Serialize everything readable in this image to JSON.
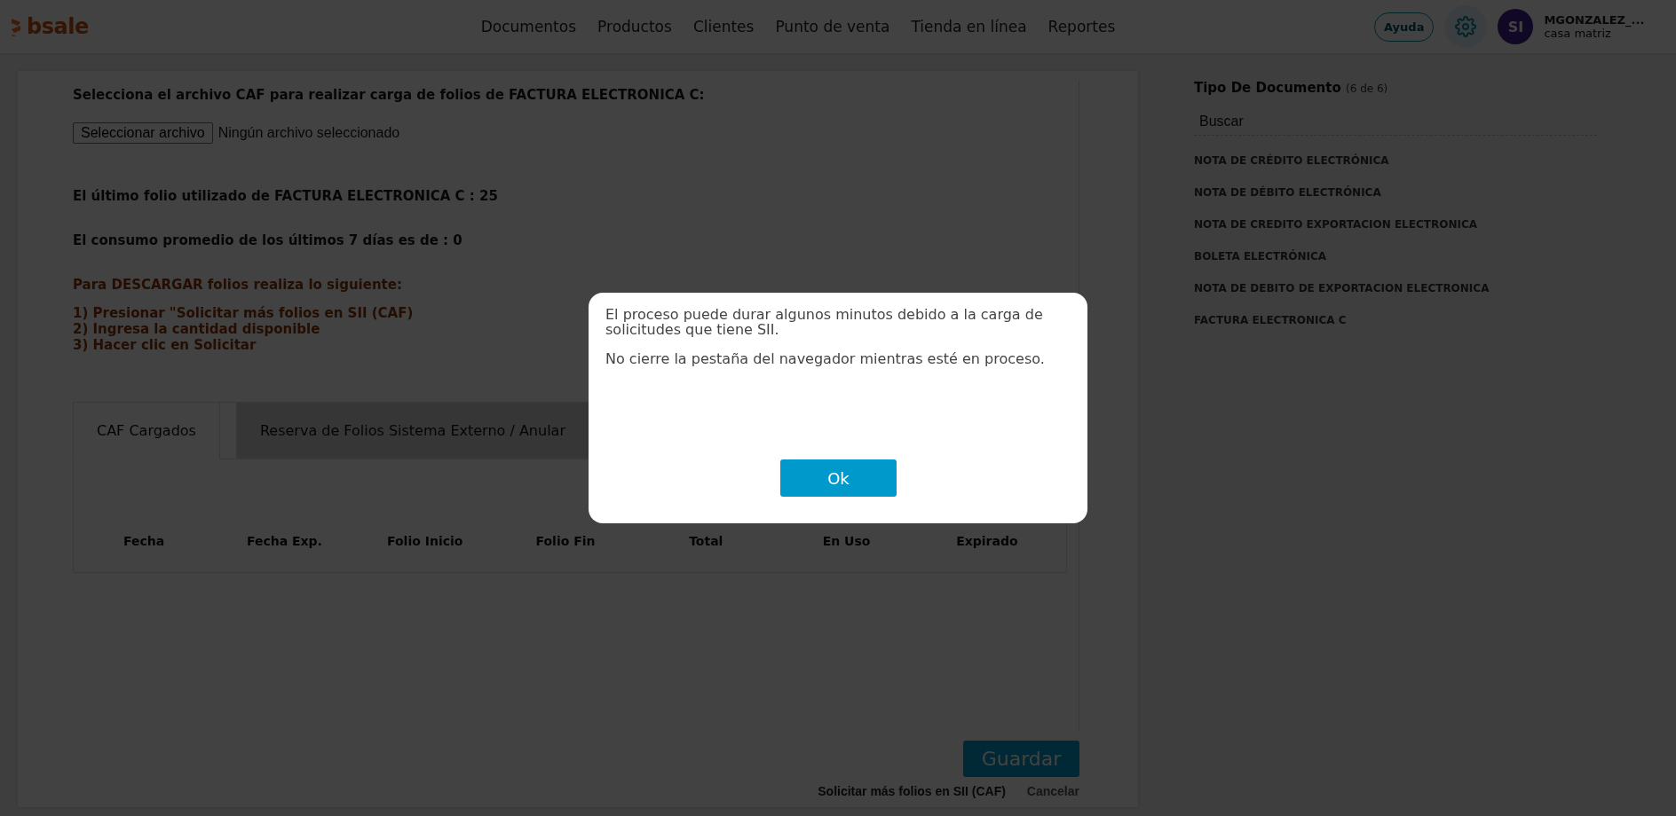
{
  "header": {
    "logo": "bsale",
    "nav": [
      {
        "label": "Documentos"
      },
      {
        "label": "Productos"
      },
      {
        "label": "Clientes"
      },
      {
        "label": "Punto de venta"
      },
      {
        "label": "Tienda en línea"
      },
      {
        "label": "Reportes"
      }
    ],
    "help_button": "Ayuda",
    "user": {
      "initials": "SI",
      "name": "MGONZALEZ_...",
      "branch": "casa matriz"
    }
  },
  "upload": {
    "prompt": "Selecciona el archivo CAF para realizar carga de folios de FACTURA ELECTRONICA C:",
    "file_button": "Seleccionar archivo",
    "file_status": "Ningún archivo seleccionado"
  },
  "last_folio": "El último folio utilizado de FACTURA ELECTRONICA C : 25",
  "consumption": "El consumo promedio de los últimos 7 días es de : 0",
  "instructions": {
    "title": "Para DESCARGAR folios realiza lo siguiente:",
    "steps": [
      "1) Presionar \"Solicitar más folios en SII (CAF)",
      "2) Ingresa la cantidad disponible",
      "3) Hacer clic en Solicitar"
    ]
  },
  "tabs": [
    {
      "label": "CAF Cargados",
      "selected": true
    },
    {
      "label": "Reserva de Folios Sistema Externo / Anular",
      "selected": false
    }
  ],
  "table": {
    "columns": [
      "Fecha",
      "Fecha Exp.",
      "Folio Inicio",
      "Folio Fin",
      "Total",
      "En Uso",
      "Expirado"
    ]
  },
  "actions": {
    "save": "Guardar",
    "request": "Solicitar más folios en SII (CAF)",
    "cancel": "Cancelar"
  },
  "sidebar": {
    "title": "Tipo De Documento",
    "count": "(6 de 6)",
    "search": {
      "placeholder": "Buscar"
    },
    "items": [
      "NOTA DE CRÉDITO ELECTRÓNICA",
      "NOTA DE DÉBITO ELECTRÓNICA",
      "NOTA DE CREDITO EXPORTACION ELECTRONICA",
      "BOLETA ELECTRÓNICA",
      "NOTA DE DEBITO DE EXPORTACION ELECTRONICA",
      "FACTURA ELECTRONICA C"
    ]
  },
  "dialog": {
    "messages": [
      "El proceso puede durar algunos minutos debido a la carga de solicitudes que tiene SII.",
      "No cierre la pestaña del navegador mientras esté en proceso."
    ],
    "button": "Ok"
  }
}
